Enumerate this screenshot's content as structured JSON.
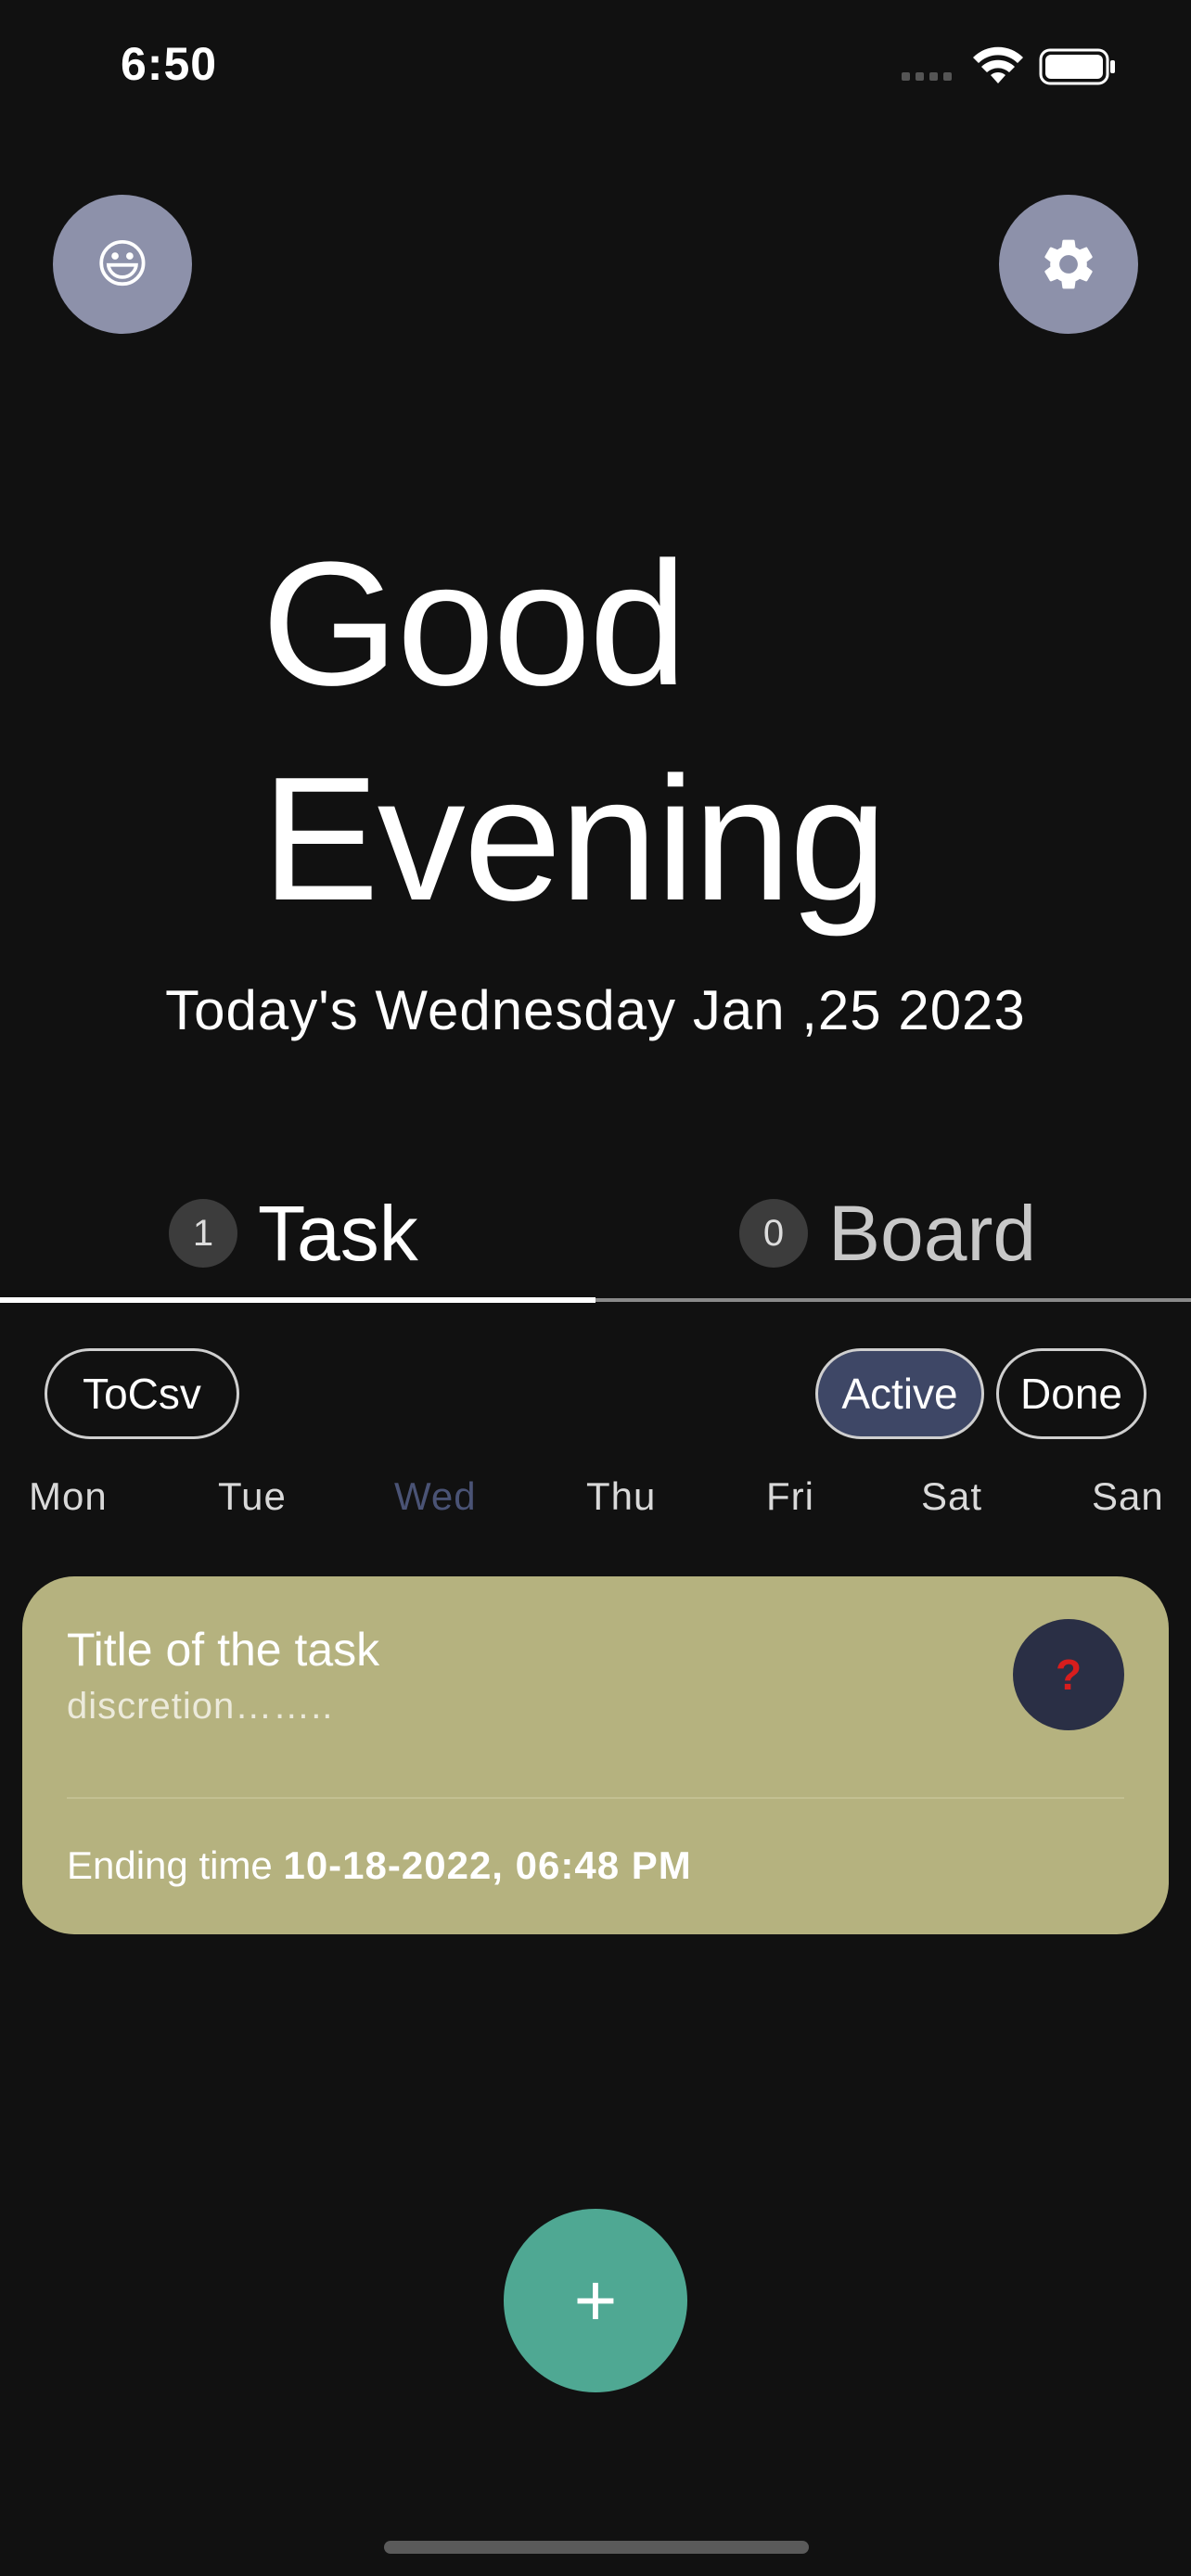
{
  "status_bar": {
    "time": "6:50"
  },
  "header": {
    "avatar_emoji": "😃",
    "avatar_icon": "smiley-emoji",
    "settings_icon": "gear-icon",
    "settings_color": "#8d91aa"
  },
  "greeting": {
    "line1": "Good",
    "line2": "Evening",
    "date": "Today's Wednesday Jan ,25 2023"
  },
  "tabs": [
    {
      "count": "1",
      "label": "Task",
      "selected": true
    },
    {
      "count": "0",
      "label": "Board",
      "selected": false
    }
  ],
  "filters": {
    "export_label": "ToCsv",
    "active_label": "Active",
    "done_label": "Done",
    "active_selected": true
  },
  "days": {
    "items": [
      "Mon",
      "Tue",
      "Wed",
      "Thu",
      "Fri",
      "Sat",
      "San"
    ],
    "selected": "Wed"
  },
  "task": {
    "title": "Title of the task",
    "description": "discretion……..",
    "status_symbol": "?",
    "ending_label": "Ending time",
    "ending_value": "10-18-2022, 06:48 PM",
    "card_color": "#b5b27f"
  },
  "fab": {
    "label": "+",
    "color": "#4fa893"
  },
  "colors": {
    "background": "#111111",
    "accent_chip": "#3e4766",
    "selected_day": "#4a5375",
    "status_red": "#d81d1d"
  }
}
